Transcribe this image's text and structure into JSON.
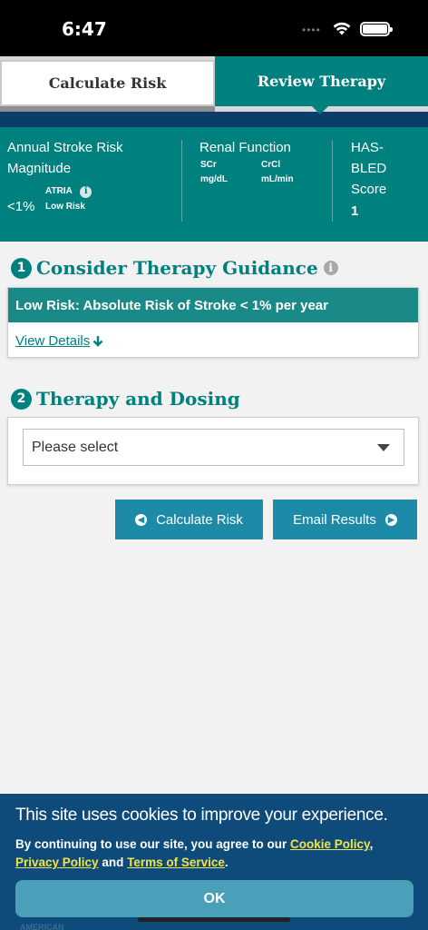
{
  "status_bar": {
    "time": "6:47",
    "dots": "••••"
  },
  "tabs": {
    "calculate": "Calculate Risk",
    "review": "Review Therapy"
  },
  "summary": {
    "stroke_risk": {
      "title_line1": "Annual Stroke Risk",
      "title_line2": "Magnitude",
      "value": "<1%",
      "source": "ATRIA",
      "level": "Low Risk"
    },
    "renal": {
      "title": "Renal Function",
      "scr_label": "SCr",
      "scr_unit": "mg/dL",
      "crcl_label": "CrCl",
      "crcl_unit": "mL/min"
    },
    "hasbled": {
      "title_line1": "HAS-",
      "title_line2": "BLED",
      "title_line3": "Score",
      "value": "1"
    }
  },
  "section1": {
    "number": "1",
    "title": "Consider Therapy Guidance",
    "risk_text": "Low Risk: Absolute Risk of Stroke < 1% per year",
    "view_details": "View Details"
  },
  "section2": {
    "number": "2",
    "title": "Therapy and Dosing",
    "select_value": "Please select"
  },
  "buttons": {
    "calculate_risk": "Calculate Risk",
    "email_results": "Email Results"
  },
  "cookie": {
    "title": "This site uses cookies to improve your experience.",
    "text_prefix": "By continuing to use our site, you agree to our ",
    "cookie_policy": "Cookie Policy",
    "comma": ",",
    "privacy_policy": "Privacy Policy",
    "and": " and ",
    "terms": "Terms of Service",
    "period": ".",
    "ok": "OK",
    "logo_partial": "AMERICAN"
  },
  "colors": {
    "teal": "#00807e",
    "navy": "#0e4b7a",
    "button_blue": "#1d8aa8",
    "link_yellow": "#f3e34a"
  }
}
